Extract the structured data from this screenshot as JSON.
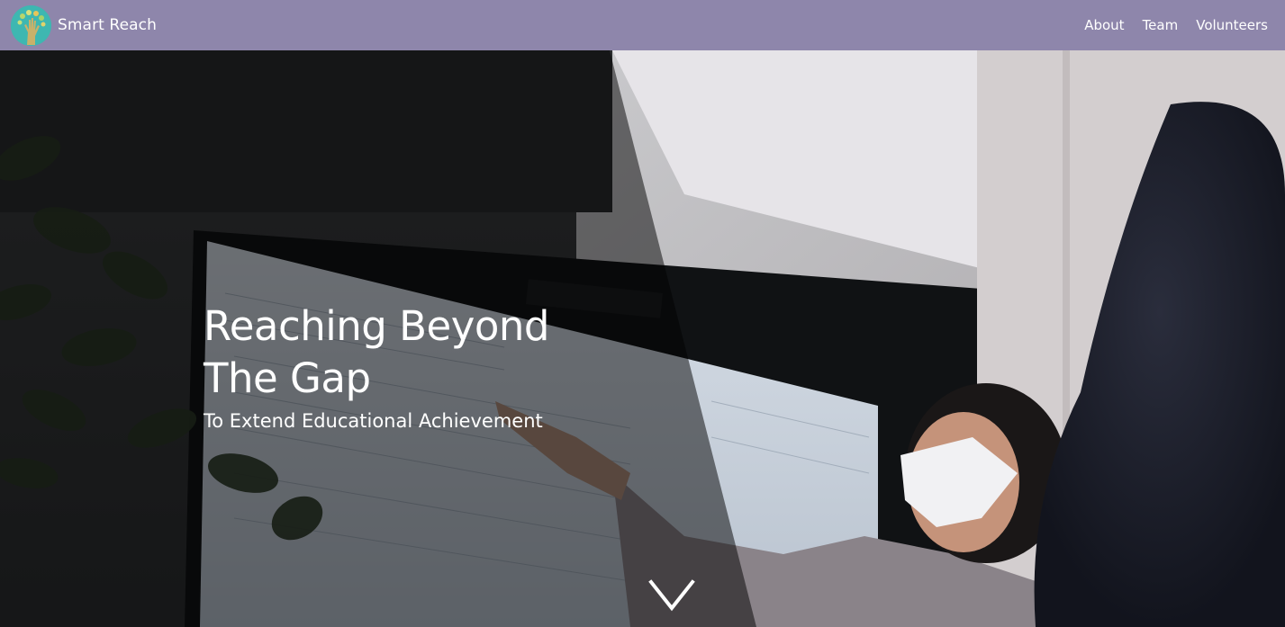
{
  "navbar": {
    "brand": {
      "name": "Smart Reach",
      "logo_icon": "tree-hand-logo-icon"
    },
    "links": [
      {
        "label": "About"
      },
      {
        "label": "Team"
      },
      {
        "label": "Volunteers"
      }
    ],
    "background_color": "#8e86ab"
  },
  "hero": {
    "title_line1": "Reaching Beyond",
    "title_line2": "The Gap",
    "subtitle": "To Extend Educational Achievement",
    "scroll_icon": "chevron-down-icon",
    "overlay_color": "#000000"
  }
}
